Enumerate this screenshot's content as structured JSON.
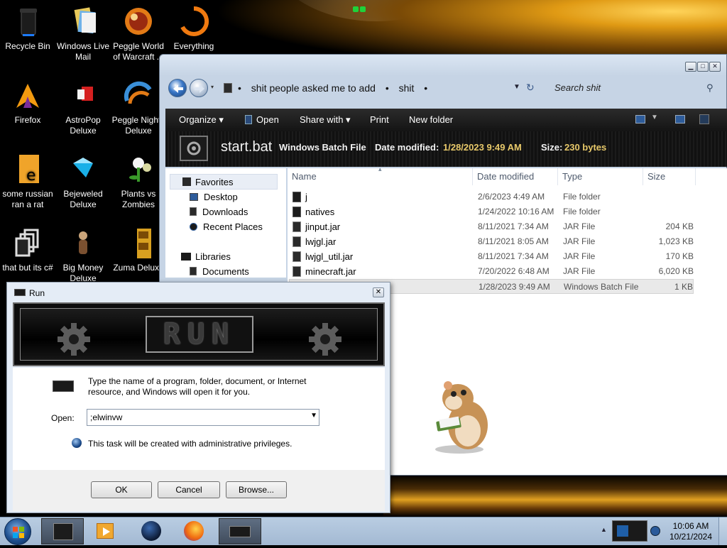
{
  "desktop": {
    "icons": [
      {
        "label": "Recycle Bin",
        "icon": "recycle-bin-icon"
      },
      {
        "label": "Windows Live Mail",
        "icon": "mail-icon"
      },
      {
        "label": "Peggle World of Warcraft ...",
        "icon": "peggle-icon"
      },
      {
        "label": "Everything",
        "icon": "search-icon"
      },
      {
        "label": "Firefox",
        "icon": "firefox-icon"
      },
      {
        "label": "AstroPop Deluxe",
        "icon": "game-icon"
      },
      {
        "label": "Peggle Nights Deluxe",
        "icon": "peggle-icon"
      },
      {
        "label": "some russian ran a rat",
        "icon": "file-icon"
      },
      {
        "label": "Bejeweled Deluxe",
        "icon": "gem-icon"
      },
      {
        "label": "Plants vs Zombies",
        "icon": "plant-icon"
      },
      {
        "label": "that but its c#",
        "icon": "shortcut-icon"
      },
      {
        "label": "Big Money Deluxe",
        "icon": "money-icon"
      },
      {
        "label": "Zuma Deluxe",
        "icon": "zuma-icon"
      }
    ]
  },
  "explorer": {
    "breadcrumb": [
      "shit people asked me to add",
      "shit"
    ],
    "search_placeholder": "Search shit",
    "toolbar": {
      "organize": "Organize",
      "open": "Open",
      "share_with": "Share with",
      "print": "Print",
      "new_folder": "New folder"
    },
    "details": {
      "file_name": "start.bat",
      "file_type": "Windows Batch File",
      "date_label": "Date modified:",
      "date_value": "1/28/2023 9:49 AM",
      "size_label": "Size:",
      "size_value": "230 bytes"
    },
    "nav": {
      "favorites": "Favorites",
      "desktop": "Desktop",
      "downloads": "Downloads",
      "recent_places": "Recent Places",
      "libraries": "Libraries",
      "documents": "Documents"
    },
    "columns": {
      "name": "Name",
      "date": "Date modified",
      "type": "Type",
      "size": "Size"
    },
    "files": [
      {
        "name": "j",
        "date": "2/6/2023 4:49 AM",
        "type": "File folder",
        "size": "",
        "kind": "folder"
      },
      {
        "name": "natives",
        "date": "1/24/2022 10:16 AM",
        "type": "File folder",
        "size": "",
        "kind": "folder"
      },
      {
        "name": "jinput.jar",
        "date": "8/11/2021 7:34 AM",
        "type": "JAR File",
        "size": "204 KB",
        "kind": "jar"
      },
      {
        "name": "lwjgl.jar",
        "date": "8/11/2021 8:05 AM",
        "type": "JAR File",
        "size": "1,023 KB",
        "kind": "jar"
      },
      {
        "name": "lwjgl_util.jar",
        "date": "8/11/2021 7:34 AM",
        "type": "JAR File",
        "size": "170 KB",
        "kind": "jar"
      },
      {
        "name": "minecraft.jar",
        "date": "7/20/2022 6:48 AM",
        "type": "JAR File",
        "size": "6,020 KB",
        "kind": "jar"
      },
      {
        "name": "",
        "date": "1/28/2023 9:49 AM",
        "type": "Windows Batch File",
        "size": "1 KB",
        "kind": "bat"
      }
    ]
  },
  "run_dialog": {
    "title": "Run",
    "banner_text": "RUN",
    "description": "Type the name of a program, folder, document, or Internet resource, and Windows will open it for you.",
    "open_label": "Open:",
    "open_value": ";elwinvw",
    "admin_note": "This task will be created with administrative privileges.",
    "ok": "OK",
    "cancel": "Cancel",
    "browse": "Browse..."
  },
  "taskbar": {
    "time": "10:06 AM",
    "date": "10/21/2024"
  },
  "colors": {
    "accent_gold": "#e09a14",
    "explorer_frame": "#c6d4e5",
    "toolbar_dark": "#141414",
    "taskbar": "#b9cde2"
  }
}
